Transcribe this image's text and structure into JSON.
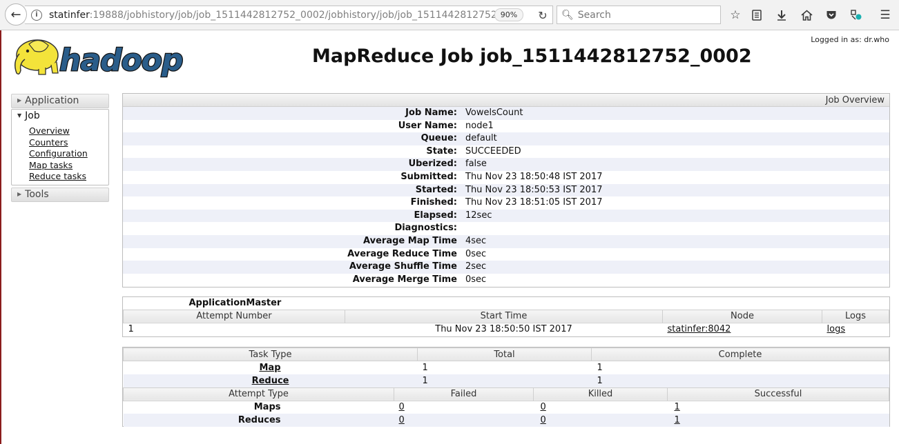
{
  "browser": {
    "url_host": "statinfer",
    "url_rest": ":19888/jobhistory/job/job_1511442812752_0002/jobhistory/job/job_1511442812752_",
    "zoom": "90%",
    "search_placeholder": "Search"
  },
  "header": {
    "logged_in": "Logged in as: dr.who",
    "logo_text": "hadoop",
    "title": "MapReduce Job job_1511442812752_0002"
  },
  "sidebar": {
    "application": "Application",
    "job": "Job",
    "job_links": [
      "Overview",
      "Counters",
      "Configuration",
      "Map tasks",
      "Reduce tasks"
    ],
    "tools": "Tools"
  },
  "overview": {
    "heading": "Job Overview",
    "rows": [
      {
        "label": "Job Name:",
        "value": "VowelsCount"
      },
      {
        "label": "User Name:",
        "value": "node1"
      },
      {
        "label": "Queue:",
        "value": "default"
      },
      {
        "label": "State:",
        "value": "SUCCEEDED"
      },
      {
        "label": "Uberized:",
        "value": "false"
      },
      {
        "label": "Submitted:",
        "value": "Thu Nov 23 18:50:48 IST 2017"
      },
      {
        "label": "Started:",
        "value": "Thu Nov 23 18:50:53 IST 2017"
      },
      {
        "label": "Finished:",
        "value": "Thu Nov 23 18:51:05 IST 2017"
      },
      {
        "label": "Elapsed:",
        "value": "12sec"
      },
      {
        "label": "Diagnostics:",
        "value": ""
      },
      {
        "label": "Average Map Time",
        "value": "4sec"
      },
      {
        "label": "Average Reduce Time",
        "value": "0sec"
      },
      {
        "label": "Average Shuffle Time",
        "value": "2sec"
      },
      {
        "label": "Average Merge Time",
        "value": "0sec"
      }
    ]
  },
  "app_master": {
    "caption": "ApplicationMaster",
    "headers": [
      "Attempt Number",
      "Start Time",
      "Node",
      "Logs"
    ],
    "row": {
      "attempt": "1",
      "start": "Thu Nov 23 18:50:50 IST 2017",
      "node": "statinfer:8042",
      "logs": "logs"
    }
  },
  "tasks": {
    "headers": [
      "Task Type",
      "Total",
      "Complete"
    ],
    "rows": [
      {
        "type": "Map",
        "total": "1",
        "complete": "1"
      },
      {
        "type": "Reduce",
        "total": "1",
        "complete": "1"
      }
    ],
    "attempt_headers": [
      "Attempt Type",
      "Failed",
      "Killed",
      "Successful"
    ],
    "attempt_rows": [
      {
        "type": "Maps",
        "failed": "0",
        "killed": "0",
        "successful": "1"
      },
      {
        "type": "Reduces",
        "failed": "0",
        "killed": "0",
        "successful": "1"
      }
    ]
  }
}
